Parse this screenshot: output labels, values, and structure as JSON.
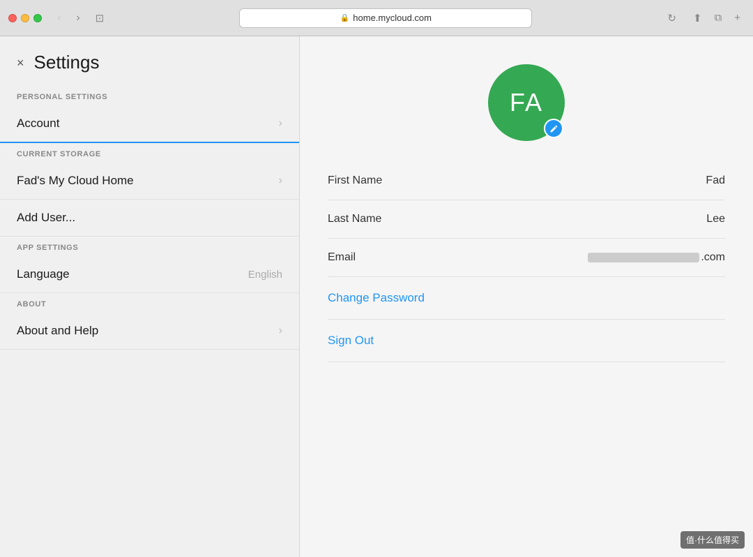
{
  "browser": {
    "url": "home.mycloud.com",
    "lock_symbol": "🔒",
    "reload_symbol": "↻"
  },
  "settings": {
    "title": "Settings",
    "close_label": "×",
    "sections": [
      {
        "id": "personal",
        "label": "PERSONAL SETTINGS",
        "items": [
          {
            "id": "account",
            "label": "Account",
            "has_chevron": true,
            "active": true
          }
        ]
      },
      {
        "id": "storage",
        "label": "CURRENT STORAGE",
        "items": [
          {
            "id": "cloud-home",
            "label": "Fad's My Cloud Home",
            "has_chevron": true,
            "active": false
          },
          {
            "id": "add-user",
            "label": "Add User...",
            "has_chevron": false,
            "active": false
          }
        ]
      },
      {
        "id": "app",
        "label": "APP SETTINGS",
        "items": [
          {
            "id": "language",
            "label": "Language",
            "sub": "English",
            "has_chevron": false,
            "active": false
          }
        ]
      },
      {
        "id": "about",
        "label": "ABOUT",
        "items": [
          {
            "id": "help",
            "label": "About and Help",
            "has_chevron": true,
            "active": false
          }
        ]
      }
    ]
  },
  "profile": {
    "initials": "FA",
    "avatar_bg": "#34a853",
    "first_name_label": "First Name",
    "first_name_value": "Fad",
    "last_name_label": "Last Name",
    "last_name_value": "Lee",
    "email_label": "Email",
    "email_domain": ".com",
    "change_password_label": "Change Password",
    "sign_out_label": "Sign Out"
  },
  "watermark": "值·什么值得买"
}
